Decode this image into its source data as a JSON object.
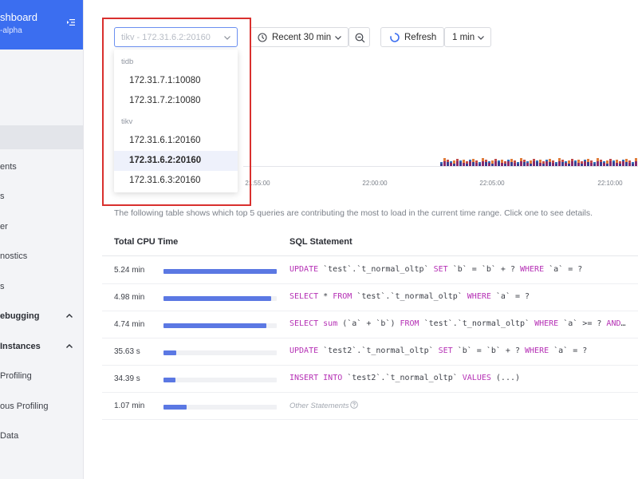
{
  "sidebar": {
    "brand_title": "shboard",
    "brand_sub": "-alpha",
    "items": [
      {
        "label": "ents"
      },
      {
        "label": "s"
      },
      {
        "label": "er"
      },
      {
        "label": "nostics"
      },
      {
        "label": "s"
      },
      {
        "label": "ebugging"
      },
      {
        "label": " Instances"
      },
      {
        "label": "Profiling"
      },
      {
        "label": "ous Profiling"
      },
      {
        "label": "Data"
      }
    ]
  },
  "toolbar": {
    "instance_select_value": "tikv - 172.31.6.2:20160",
    "time_range_label": "Recent 30 min",
    "refresh_label": "Refresh",
    "interval_label": "1 min"
  },
  "dropdown": {
    "groups": [
      {
        "name": "tidb",
        "options": [
          "172.31.7.1:10080",
          "172.31.7.2:10080"
        ]
      },
      {
        "name": "tikv",
        "options": [
          "172.31.6.1:20160",
          "172.31.6.2:20160",
          "172.31.6.3:20160"
        ]
      }
    ],
    "selected": "172.31.6.2:20160"
  },
  "chart": {
    "time_ticks": [
      "21:55:00",
      "22:00:00",
      "22:05:00",
      "22:10:00"
    ]
  },
  "table": {
    "description": "The following table shows which top 5 queries are contributing the most to load in the current time range. Click one to see details.",
    "columns": {
      "cpu": "Total CPU Time",
      "sql": "SQL Statement"
    },
    "rows": [
      {
        "cpu": "5.24 min",
        "fraction": 1.0,
        "sql_tokens": [
          [
            "kw",
            "UPDATE"
          ],
          [
            "p",
            " `test`.`t_normal_oltp` "
          ],
          [
            "kw",
            "SET"
          ],
          [
            "p",
            " `b` = `b` + ? "
          ],
          [
            "kw",
            "WHERE"
          ],
          [
            "p",
            " `a` = ?"
          ]
        ]
      },
      {
        "cpu": "4.98 min",
        "fraction": 0.95,
        "sql_tokens": [
          [
            "kw",
            "SELECT"
          ],
          [
            "p",
            " * "
          ],
          [
            "kw",
            "FROM"
          ],
          [
            "p",
            " `test`.`t_normal_oltp` "
          ],
          [
            "kw",
            "WHERE"
          ],
          [
            "p",
            " `a` = ?"
          ]
        ]
      },
      {
        "cpu": "4.74 min",
        "fraction": 0.905,
        "sql_tokens": [
          [
            "kw",
            "SELECT"
          ],
          [
            "p",
            " "
          ],
          [
            "kw",
            "sum"
          ],
          [
            "p",
            " (`a` + `b`) "
          ],
          [
            "kw",
            "FROM"
          ],
          [
            "p",
            " `test`.`t_normal_oltp` "
          ],
          [
            "kw",
            "WHERE"
          ],
          [
            "p",
            " `a` >= ? "
          ],
          [
            "kw",
            "AND"
          ],
          [
            "p",
            "…"
          ]
        ]
      },
      {
        "cpu": "35.63 s",
        "fraction": 0.113,
        "sql_tokens": [
          [
            "kw",
            "UPDATE"
          ],
          [
            "p",
            " `test2`.`t_normal_oltp` "
          ],
          [
            "kw",
            "SET"
          ],
          [
            "p",
            " `b` = `b` + ? "
          ],
          [
            "kw",
            "WHERE"
          ],
          [
            "p",
            " `a` = ?"
          ]
        ]
      },
      {
        "cpu": "34.39 s",
        "fraction": 0.109,
        "sql_tokens": [
          [
            "kw",
            "INSERT"
          ],
          [
            "p",
            " "
          ],
          [
            "kw",
            "INTO"
          ],
          [
            "p",
            " `test2`.`t_normal_oltp` "
          ],
          [
            "kw",
            "VALUES"
          ],
          [
            "p",
            " (...)"
          ]
        ]
      },
      {
        "cpu": "1.07 min",
        "fraction": 0.204,
        "other": true,
        "other_label": "Other Statements"
      }
    ]
  },
  "colors": {
    "brand": "#3b6ef0",
    "bar": "#5b78e3",
    "keyword": "#b530b5",
    "highlight": "#d9302e"
  }
}
